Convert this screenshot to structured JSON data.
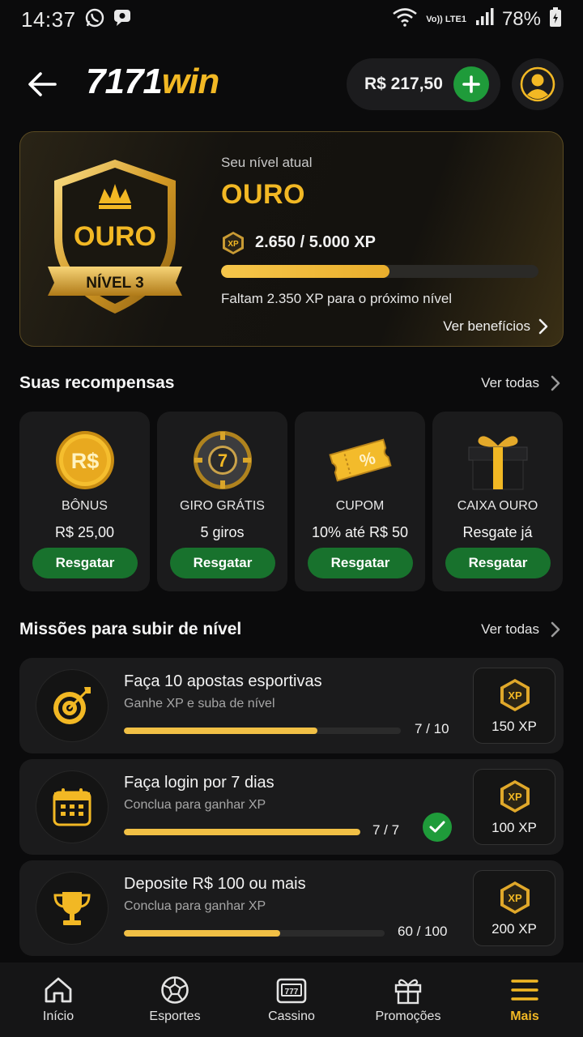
{
  "status_bar": {
    "time": "14:37",
    "network": "Vo)) LTE1",
    "battery": "78%"
  },
  "header": {
    "logo_number": "7171",
    "logo_word": "win",
    "balance": "R$ 217,50"
  },
  "level_card": {
    "subtitle": "Seu nível atual",
    "level_name": "OURO",
    "shield_title": "OURO",
    "shield_ribbon": "NÍVEL 3",
    "xp_label": "XP",
    "xp_progress": "2.650 / 5.000 XP",
    "xp_fraction": 0.53,
    "remaining": "Faltam 2.350 XP para o próximo nível",
    "benefits_link": "Ver benefícios"
  },
  "rewards_section": {
    "title": "Suas recompensas",
    "see_all": "Ver todas",
    "items": [
      {
        "name": "BÔNUS",
        "value": "R$ 25,00",
        "button": "Resgatar",
        "icon": "coin-icon",
        "icon_text": "R$"
      },
      {
        "name": "GIRO GRÁTIS",
        "value": "5 giros",
        "button": "Resgatar",
        "icon": "wheel-icon",
        "icon_text": "7"
      },
      {
        "name": "CUPOM",
        "value": "10% até R$ 50",
        "button": "Resgatar",
        "icon": "coupon-icon",
        "icon_text": "%"
      },
      {
        "name": "CAIXA OURO",
        "value": "Resgate já",
        "button": "Resgatar",
        "icon": "gift-box-icon"
      }
    ]
  },
  "missions_section": {
    "title": "Missões para subir de nível",
    "see_all": "Ver todas",
    "items": [
      {
        "title": "Faça 10 apostas esportivas",
        "subtitle": "Ganhe XP e suba de nível",
        "progress": "7 / 10",
        "fraction": 0.7,
        "completed": false,
        "reward_label": "XP",
        "reward": "150 XP",
        "icon": "target-icon"
      },
      {
        "title": "Faça login por 7 dias",
        "subtitle": "Conclua para ganhar XP",
        "progress": "7 / 7",
        "fraction": 1.0,
        "completed": true,
        "reward_label": "XP",
        "reward": "100 XP",
        "icon": "calendar-icon"
      },
      {
        "title": "Deposite R$ 100 ou mais",
        "subtitle": "Conclua para ganhar XP",
        "progress": "60 / 100",
        "fraction": 0.6,
        "completed": false,
        "reward_label": "XP",
        "reward": "200 XP",
        "icon": "trophy-icon"
      }
    ]
  },
  "bottom_nav": {
    "items": [
      {
        "label": "Início",
        "icon": "home-icon",
        "active": false
      },
      {
        "label": "Esportes",
        "icon": "soccer-ball-icon",
        "active": false
      },
      {
        "label": "Cassino",
        "icon": "slot-machine-icon",
        "active": false
      },
      {
        "label": "Promoções",
        "icon": "gift-icon",
        "active": false
      },
      {
        "label": "Mais",
        "icon": "menu-icon",
        "active": true
      }
    ]
  },
  "colors": {
    "gold": "#f2b824",
    "green": "#1f9b3a",
    "background": "#0b0b0c",
    "card": "#1b1b1c"
  }
}
